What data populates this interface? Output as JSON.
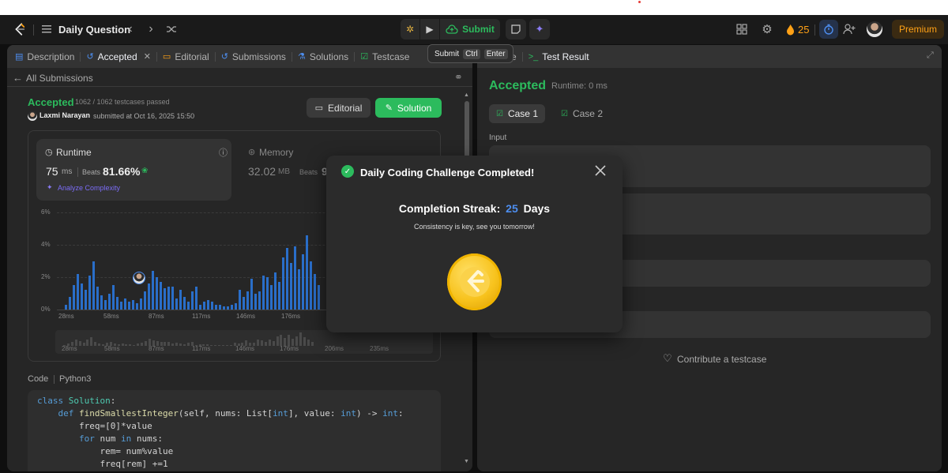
{
  "topbar": {
    "title": "Daily Question",
    "submit_label": "Submit",
    "streak_count": "25",
    "premium_label": "Premium"
  },
  "tooltip": {
    "label": "Submit",
    "key1": "Ctrl",
    "key2": "Enter"
  },
  "left_tabs": [
    {
      "label": "Description"
    },
    {
      "label": "Accepted"
    },
    {
      "label": "Editorial"
    },
    {
      "label": "Submissions"
    },
    {
      "label": "Solutions"
    },
    {
      "label": "Testcase"
    }
  ],
  "right_tabs": {
    "partial": "e",
    "test_result": "Test Result"
  },
  "submission": {
    "back_label": "All Submissions",
    "status": "Accepted",
    "testcases": "1062 / 1062 testcases passed",
    "user": "Laxmi Narayan",
    "submitted_at": "submitted at Oct 16, 2025 15:50",
    "editorial_btn": "Editorial",
    "solution_btn": "Solution"
  },
  "runtime": {
    "title": "Runtime",
    "value": "75",
    "unit": "ms",
    "beats_label": "Beats",
    "beats_value": "81.66%",
    "analyze": "Analyze Complexity"
  },
  "memory": {
    "title": "Memory",
    "value": "32.02",
    "unit": "MB",
    "beats_label": "Beats",
    "beats_partial": "9"
  },
  "chart_data": {
    "type": "bar",
    "y_ticks": [
      "6%",
      "4%",
      "2%",
      "0%"
    ],
    "x_ticks": [
      "28ms",
      "58ms",
      "87ms",
      "117ms",
      "146ms",
      "176ms"
    ],
    "mini_x_ticks": [
      "28ms",
      "58ms",
      "87ms",
      "117ms",
      "146ms",
      "176ms",
      "206ms",
      "235ms"
    ],
    "ylim": [
      0,
      6
    ],
    "values": [
      0.3,
      0.8,
      1.5,
      2.2,
      1.6,
      1.2,
      2.1,
      3.0,
      1.4,
      0.9,
      0.6,
      1.0,
      1.5,
      0.8,
      0.5,
      0.7,
      0.5,
      0.6,
      0.4,
      0.7,
      1.1,
      1.6,
      2.4,
      2.0,
      1.7,
      1.3,
      1.4,
      1.4,
      0.7,
      1.2,
      0.8,
      0.5,
      1.1,
      1.4,
      0.3,
      0.5,
      0.6,
      0.5,
      0.3,
      0.3,
      0.2,
      0.2,
      0.3,
      0.4,
      1.2,
      0.8,
      1.1,
      1.9,
      1.0,
      1.1,
      2.1,
      2.0,
      1.5,
      2.3,
      1.7,
      3.2,
      3.8,
      2.9,
      3.9,
      2.5,
      3.4,
      4.6,
      3.0,
      2.2,
      1.5
    ]
  },
  "code": {
    "label": "Code",
    "language": "Python3",
    "lines": [
      "class Solution:",
      "    def findSmallestInteger(self, nums: List[int], value: int) -> int:",
      "        freq=[0]*value",
      "        for num in nums:",
      "            rem= num%value",
      "            freq[rem] +=1"
    ]
  },
  "result": {
    "status": "Accepted",
    "runtime": "Runtime: 0 ms",
    "case1": "Case 1",
    "case2": "Case 2",
    "input_label": "Input",
    "contribute": "Contribute a testcase"
  },
  "modal": {
    "title": "Daily Coding Challenge Completed!",
    "streak_label": "Completion Streak:",
    "streak_value": "25",
    "streak_unit": "Days",
    "message": "Consistency is key, see you tomorrow!"
  },
  "colors": {
    "accent_green": "#2cbb5d",
    "accent_blue": "#2a6ec9",
    "streak_orange": "#ffa116",
    "coin": "#ffc01e"
  }
}
